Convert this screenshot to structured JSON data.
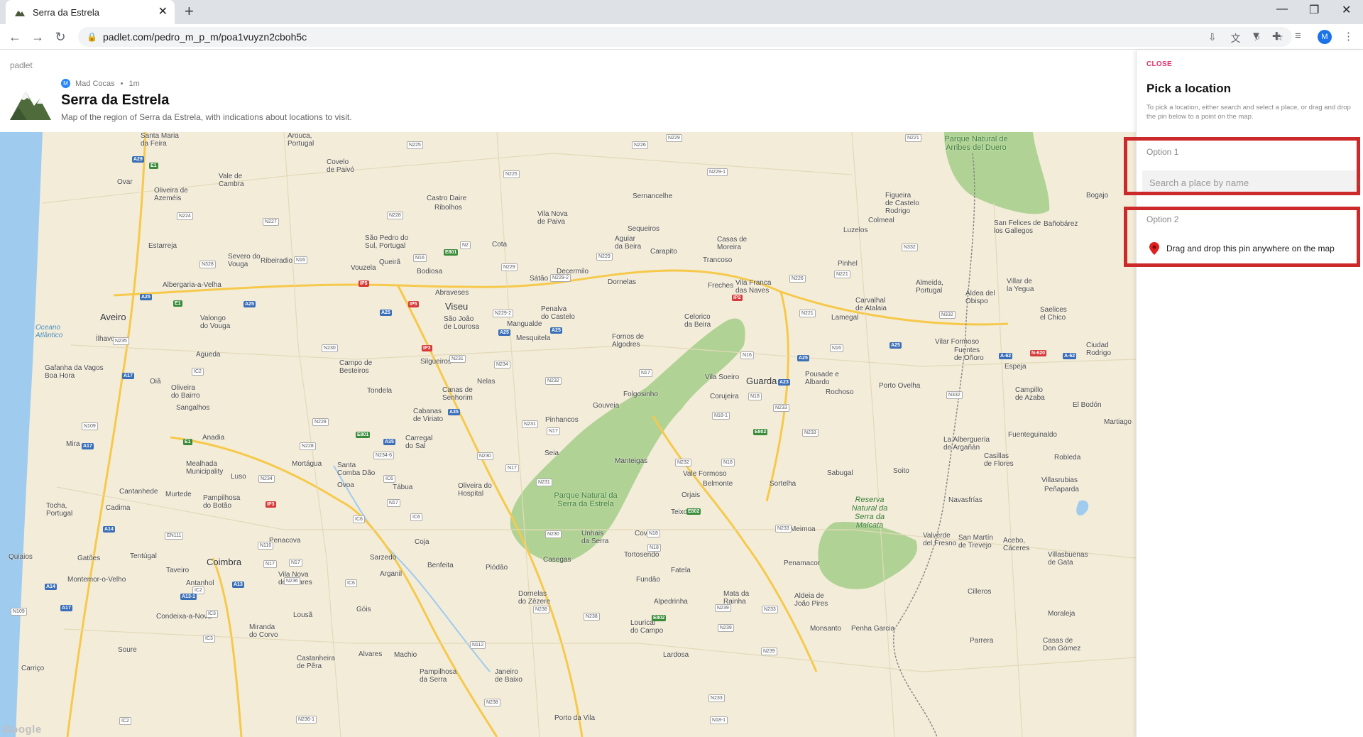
{
  "browser": {
    "tab_title": "Serra da Estrela",
    "url": "padlet.com/pedro_m_p_m/poa1vuyzn2cboh5c",
    "profile_initial": "M"
  },
  "padlet": {
    "brand": "padlet",
    "author": "Mad Cocas",
    "author_initial": "M",
    "time_ago": "1m",
    "title": "Serra da Estrela",
    "description": "Map of the region of Serra da Estrela, with indications about locations to visit."
  },
  "map": {
    "attribution": "Google",
    "places": [
      "Santa Maria da Feira",
      "Arouca",
      "Ovar",
      "Vale de Cambra",
      "Oliveira de Azeméis",
      "Estarreja",
      "Albergaria-a-Velha",
      "Aveiro",
      "Oceano Atlântico",
      "Ílhavo",
      "Gafanha da Vagos Boa Hora",
      "Oliveira do Bairro",
      "Sangalhos",
      "Anadia",
      "Mira",
      "Mealhada Municipality",
      "Cantanhede",
      "Tocha, Portugal",
      "Cadima",
      "Murtede",
      "Quiaios",
      "Gatões",
      "Tentúgal",
      "Montemor-o-Velho",
      "Coimbra",
      "Taveiro",
      "Antanhol",
      "Condeixa-a-Nova",
      "Soure",
      "Carriço",
      "Castanheira de Pêra",
      "Alvares",
      "Machio",
      "Pampilhosa da Serra",
      "Janeiro de Baixo",
      "Porto da Vila",
      "Lousã",
      "Góis",
      "Vila Nova de Poiares",
      "Miranda do Corvo",
      "Penacova",
      "Sarzedo",
      "Arganil",
      "Coja",
      "Benfeita",
      "Piódão",
      "Oliveira do Hospital",
      "Tábua",
      "Santa Comba Dão",
      "Ovoa",
      "Mortágua",
      "Tondela",
      "Campo de Besteiros",
      "Vouzela",
      "Viseu",
      "Abraveses",
      "Bodiosa",
      "São João de Lourosa",
      "Mangualde",
      "Mesquitela",
      "Nelas",
      "Canas de Senhorim",
      "Silgueiros",
      "Cabanas de Viriato",
      "Carregal do Sal",
      "Seia",
      "Pinhancos",
      "Gouveia",
      "Folgosinho",
      "Manteigas",
      "Parque Natural da Serra da Estrela",
      "Unhais da Serra",
      "Covilhã",
      "Tortosendo",
      "Teixoso",
      "Orjais",
      "Belmonte",
      "Vale Formoso",
      "Vila Soeiro",
      "Corujeira",
      "Guarda",
      "Celorico da Beira",
      "Fornos de Algodres",
      "Penalva do Castelo",
      "Dornelas",
      "Freches",
      "Vila Franca das Naves",
      "Trancoso",
      "Pinhel",
      "Carvalhal de Atalaia",
      "Lamegal",
      "Pousade e Albardo",
      "Rochoso",
      "Porto Ovelha",
      "Sortelha",
      "Sabugal",
      "Meimoa",
      "Penamacor",
      "Reserva Natural da Serra da Malcata",
      "Soito",
      "Aldeia de João Pires",
      "Mata da Rainha",
      "Alpedrinha",
      "Fundão",
      "Fatela",
      "Casegas",
      "Dornelas do Zêzere",
      "Lourical do Campo",
      "Lardosa",
      "Monsanto",
      "Penha Garcia",
      "Cilleros",
      "Moraleja",
      "Parrera",
      "Casas de Don Gómez",
      "Villasbuenas de Gata",
      "Valverde del Fresno",
      "San Martín de Trevejo",
      "Acebo, Cáceres",
      "Villasrubias",
      "Peñaparda",
      "Navasfrías",
      "Casillas de Flores",
      "Robleda",
      "Fuenteguinaldo",
      "La Alberguería de Argañán",
      "Martiago",
      "El Bodón",
      "Campillo de Azaba",
      "Espeja",
      "Fuentes de Oñoro",
      "Vilar Formoso",
      "Ciudad Rodrigo",
      "Saelices el Chico",
      "Villar de la Yegua",
      "Aldea del Obispo",
      "Almeida, Portugal",
      "San Felices de los Gallegos",
      "Bañobárez",
      "Bogajo",
      "Figueira de Castelo Rodrigo",
      "Parque Natural de Arribes del Duero",
      "Colmeal",
      "Luzelos",
      "Casas de Moreira",
      "Carapito",
      "Decermilo",
      "Sátão",
      "Aguiar da Beira",
      "Sequeiros",
      "Vila Nova de Paiva",
      "Sernancelhe",
      "Castro Daire",
      "Ribolhos",
      "Covelo de Paivó",
      "São Pedro do Sul, Portugal",
      "Queirã",
      "Severo do Vouga",
      "Ribeiradio",
      "Valongo do Vouga",
      "Agueda",
      "Oiã",
      "Lusó",
      "Pampilhosa do Botão",
      "Cota"
    ]
  },
  "panel": {
    "close_label": "CLOSE",
    "title": "Pick a location",
    "description": "To pick a location, either search and select a place, or drag and drop the pin below to a point on the map.",
    "option1_label": "Option 1",
    "search_placeholder": "Search a place by name",
    "option2_label": "Option 2",
    "pin_label": "Drag and drop this pin anywhere on the map"
  },
  "colors": {
    "close_accent": "#e0306f",
    "highlight": "#cc2a2a",
    "map_land": "#f3ecd9",
    "park_green": "#a8d08d",
    "water": "#9fcbef",
    "highway": "#f6c94b"
  }
}
